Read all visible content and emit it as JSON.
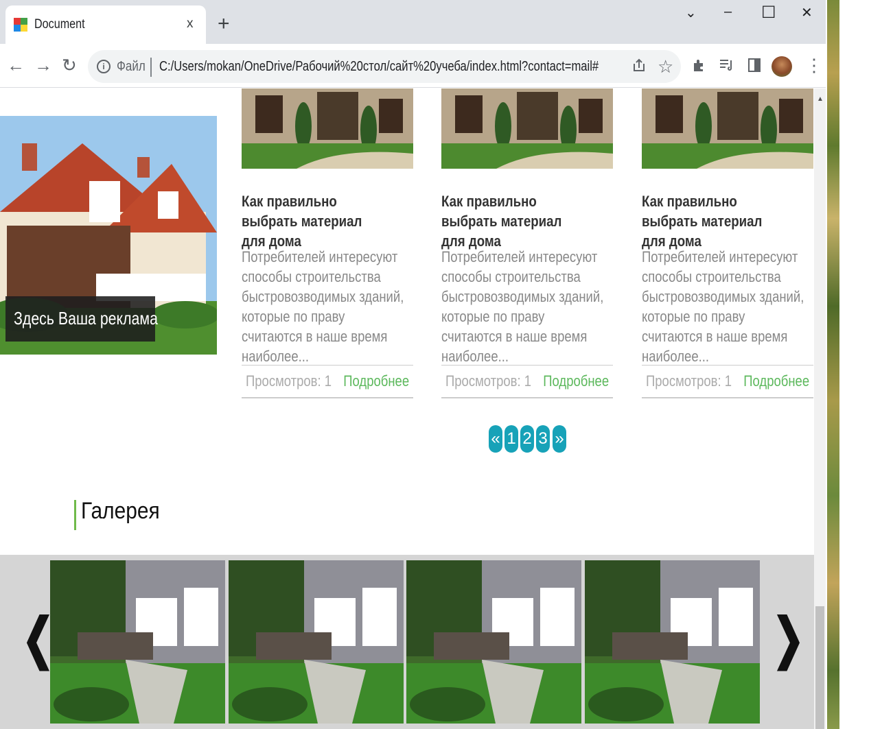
{
  "browser": {
    "tab_title": "Document",
    "tab_close": "x",
    "new_tab": "+",
    "window_controls": {
      "tab_search": "⌄",
      "minimize": "–",
      "maximize": "☐",
      "close": "✕"
    },
    "nav": {
      "back": "←",
      "forward": "→",
      "reload": "↻"
    },
    "address_label": "Файл",
    "url": "C:/Users/mokan/OneDrive/Рабочий%20стол/сайт%20учеба/index.html?contact=mail#",
    "icons": [
      "share-icon",
      "star-icon",
      "extensions-icon",
      "reading-list-icon",
      "side-panel-icon",
      "profile-avatar",
      "menu-icon"
    ]
  },
  "page": {
    "ad": {
      "label": "Здесь Ваша реклама"
    },
    "cards": [
      {
        "title": "Как правильно выбрать материал для дома",
        "text": "Потребителей интересуют способы строительства быстровозводимых зданий, которые по праву считаются в наше время наиболее...",
        "views": "Просмотров: 1",
        "more": "Подробнее"
      },
      {
        "title": "Как правильно выбрать материал для дома",
        "text": "Потребителей интересуют способы строительства быстровозводимых зданий, которые по праву считаются в наше время наиболее...",
        "views": "Просмотров: 1",
        "more": "Подробнее"
      },
      {
        "title": "Как правильно выбрать материал для дома",
        "text": "Потребителей интересуют способы строительства быстровозводимых зданий, которые по праву считаются в наше время наиболее...",
        "views": "Просмотров: 1",
        "more": "Подробнее"
      }
    ],
    "pagination": {
      "prev": "«",
      "pages": [
        "1",
        "2",
        "3"
      ],
      "next": "»"
    },
    "gallery": {
      "title": "Галерея",
      "prev": "❮",
      "next": "❯",
      "image_count": 4
    },
    "colors": {
      "accent_green": "#5cb85c",
      "pagination": "#17a2b8",
      "gallery_bg": "#d5d5d5"
    }
  }
}
